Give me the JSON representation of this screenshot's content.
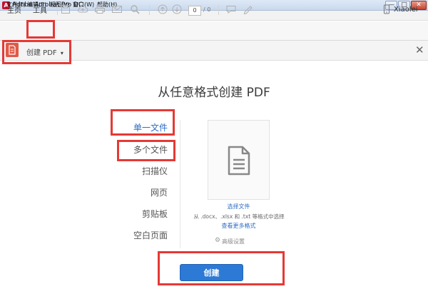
{
  "window": {
    "title": "Adobe Acrobat Pro DC",
    "controls": [
      "—",
      "□",
      "✕"
    ]
  },
  "menu": [
    {
      "label": "文件(F)"
    },
    {
      "label": "编辑(E)"
    },
    {
      "label": "视图(V)"
    },
    {
      "label": "窗口(W)"
    },
    {
      "label": "帮助(H)"
    }
  ],
  "toolbar": {
    "tabs": [
      "主页",
      "工具"
    ],
    "page_current": "0",
    "page_total": "/ 0",
    "user": "Xiaolei"
  },
  "tool_header": {
    "name": "创建 PDF",
    "dropdown_glyph": "▾"
  },
  "main": {
    "title": "从任意格式创建 PDF",
    "sources": [
      "单一文件",
      "多个文件",
      "扫描仪",
      "网页",
      "剪贴板",
      "空白页面"
    ],
    "choose_file": "选择文件",
    "format_hint": "从 .docx、.xlsx 和 .txt 等格式中选择",
    "more_formats": "查看更多格式",
    "advanced": "高级设置",
    "create_button": "创建"
  },
  "colors": {
    "accent": "#2c7ad6",
    "annotation": "#e53935",
    "pdf_icon": "#e05a47"
  }
}
